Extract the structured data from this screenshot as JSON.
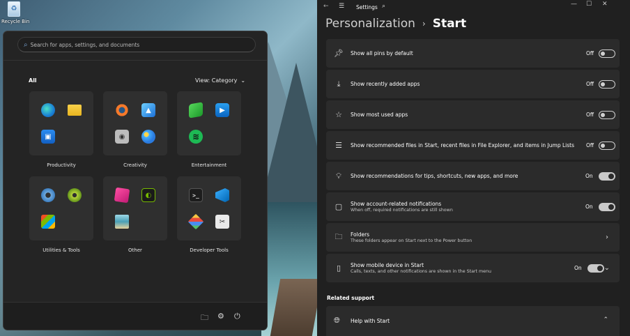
{
  "desktop": {
    "recycle_bin_label": "Recycle Bin"
  },
  "start_menu": {
    "search_placeholder": "Search for apps, settings, and documents",
    "all_label": "All",
    "view_label": "View: Category",
    "categories": [
      {
        "name": "Productivity",
        "icons": [
          "edge-icon",
          "file-explorer-icon",
          "store-icon",
          "multi-app-icon"
        ]
      },
      {
        "name": "Creativity",
        "icons": [
          "blender-icon",
          "photos-icon",
          "camera-icon",
          "paint-icon"
        ]
      },
      {
        "name": "Entertainment",
        "icons": [
          "green-app-icon",
          "movies-icon",
          "spotify-icon",
          "xbox-icon"
        ]
      },
      {
        "name": "Utilities & Tools",
        "icons": [
          "settings-gear-icon",
          "kaspersky-icon",
          "office-icon",
          "tools-icon"
        ]
      },
      {
        "name": "Other",
        "icons": [
          "pink-app-icon",
          "nvidia-icon",
          "notepad-icon",
          "multi-app-icon"
        ]
      },
      {
        "name": "Developer Tools",
        "icons": [
          "terminal-icon",
          "vscode-icon",
          "git-icon",
          "snip-icon"
        ]
      }
    ],
    "bottom_icons": [
      "documents-folder-icon",
      "settings-icon",
      "power-icon"
    ]
  },
  "settings": {
    "app_title": "Settings",
    "breadcrumb_parent": "Personalization",
    "breadcrumb_separator": "›",
    "breadcrumb_current": "Start",
    "rows": [
      {
        "label": "Show all pins by default",
        "state": "Off",
        "on": false,
        "icon": "pin-icon"
      },
      {
        "label": "Show recently added apps",
        "state": "Off",
        "on": false,
        "icon": "download-icon"
      },
      {
        "label": "Show most used apps",
        "state": "Off",
        "on": false,
        "icon": "star-icon"
      },
      {
        "label": "Show recommended files in Start, recent files in File Explorer, and items in Jump Lists",
        "state": "Off",
        "on": false,
        "icon": "list-icon"
      },
      {
        "label": "Show recommendations for tips, shortcuts, new apps, and more",
        "state": "On",
        "on": true,
        "icon": "lightbulb-icon"
      },
      {
        "label": "Show account-related notifications",
        "sublabel": "When off, required notifications are still shown",
        "state": "On",
        "on": true,
        "icon": "account-notification-icon"
      },
      {
        "label": "Folders",
        "sublabel": "These folders appear on Start next to the Power button",
        "icon": "folder-icon"
      },
      {
        "label": "Show mobile device in Start",
        "sublabel": "Calls, texts, and other notifications are shown in the Start menu",
        "state": "On",
        "on": true,
        "icon": "phone-icon"
      }
    ],
    "related_support_label": "Related support",
    "help_label": "Help with Start"
  }
}
